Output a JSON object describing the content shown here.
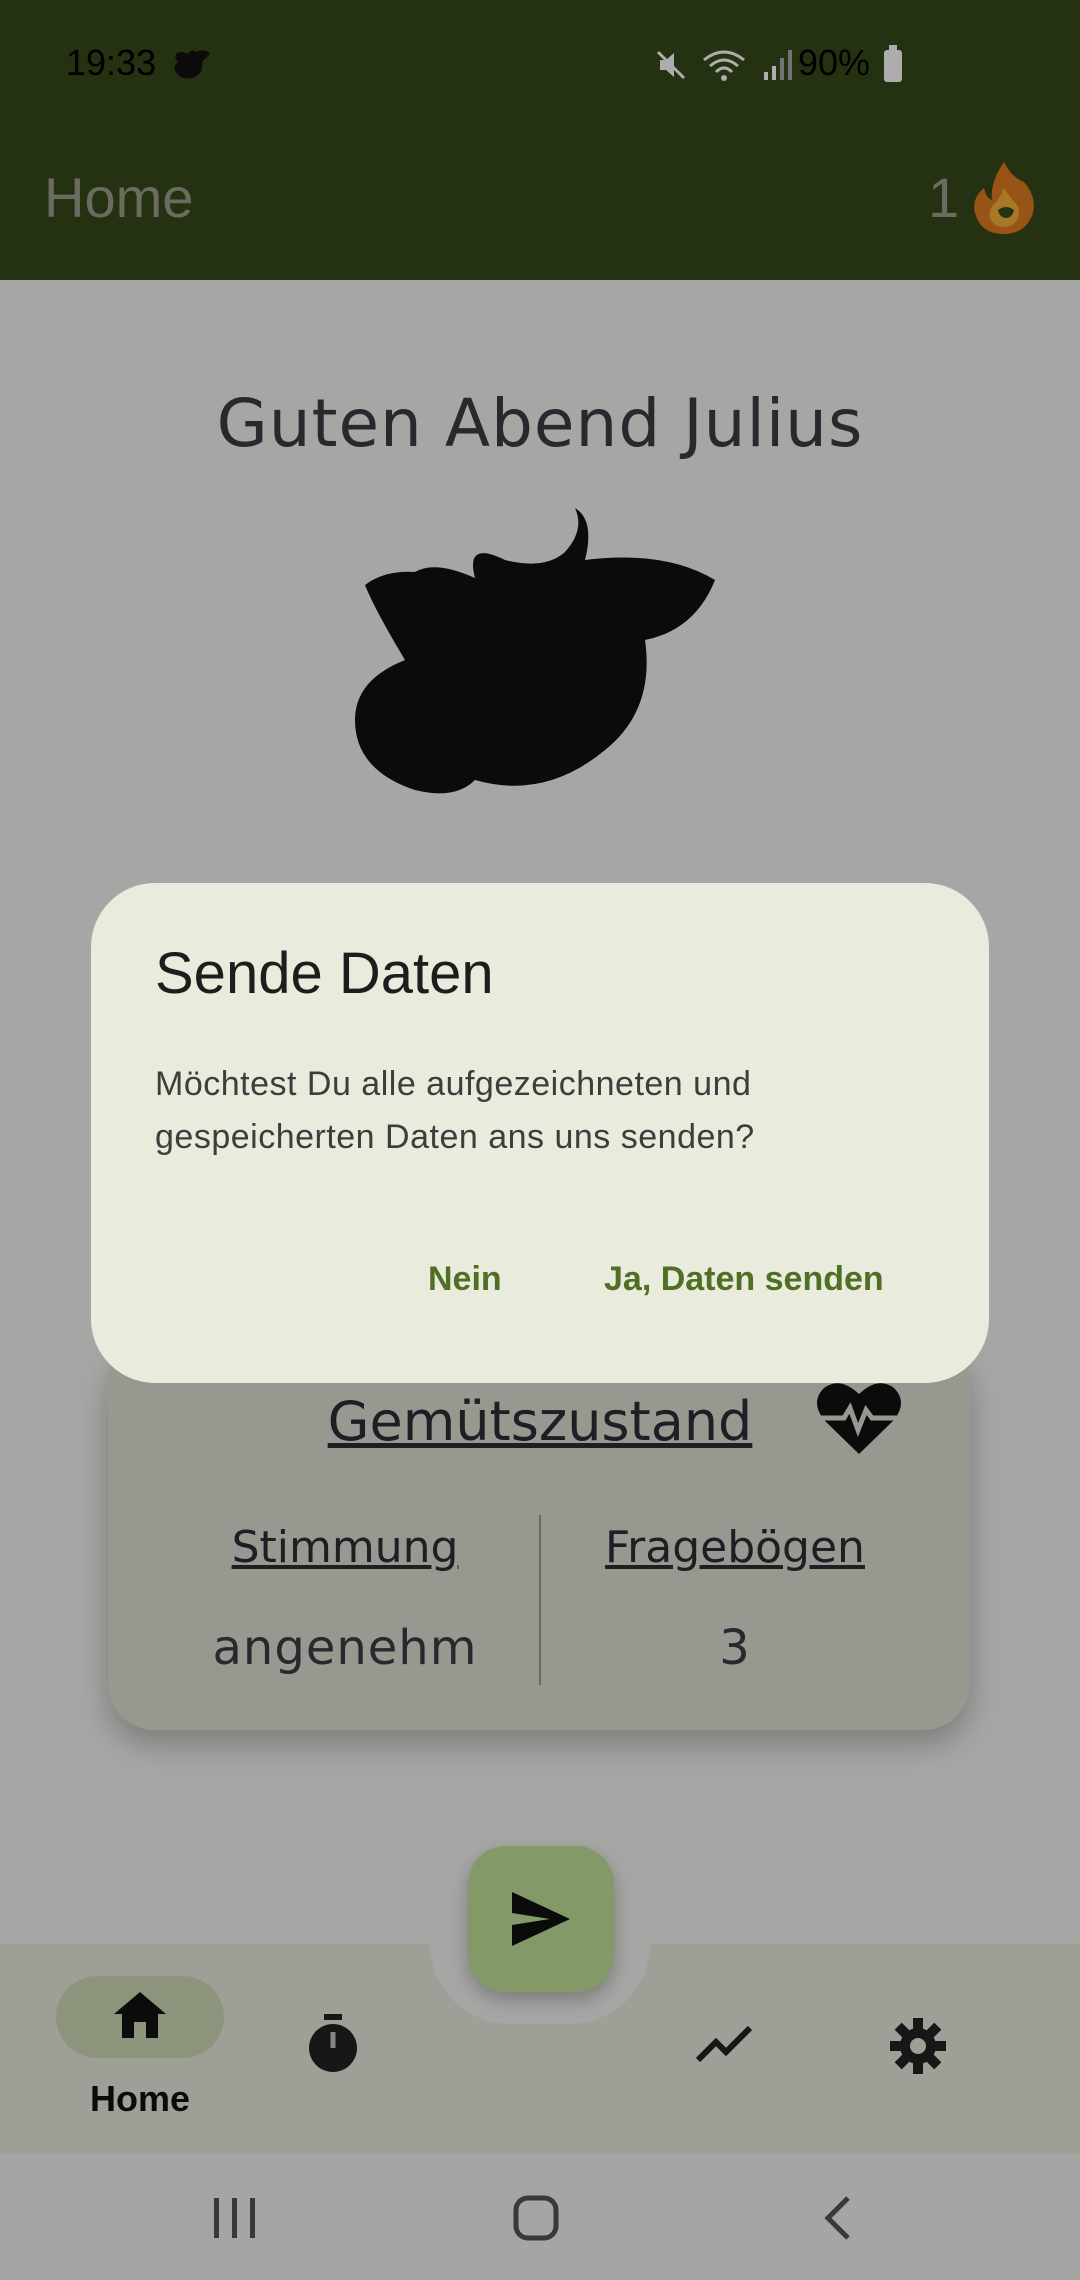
{
  "status_bar": {
    "time": "19:33",
    "battery": "90%"
  },
  "app_bar": {
    "title": "Home",
    "streak_count": "1"
  },
  "home": {
    "greeting": "Guten Abend Julius"
  },
  "mood_card": {
    "title": "Gemütszustand",
    "columns": [
      {
        "title": "Stimmung",
        "value": "angenehm"
      },
      {
        "title": "Fragebögen",
        "value": "3"
      }
    ]
  },
  "bottom_nav": {
    "items": [
      {
        "label": "Home",
        "icon": "home-icon",
        "selected": true
      },
      {
        "label": "",
        "icon": "timer-icon",
        "selected": false
      },
      {
        "label": "",
        "icon": "trending-icon",
        "selected": false
      },
      {
        "label": "",
        "icon": "gear-icon",
        "selected": false
      }
    ]
  },
  "dialog": {
    "title": "Sende Daten",
    "body": "Möchtest Du alle aufgezeichneten und gespeicherten Daten ans uns senden?",
    "cancel_label": "Nein",
    "confirm_label": "Ja, Daten senden"
  },
  "colors": {
    "app_bar": "#374a1a",
    "accent": "#4f6f25",
    "fab": "#c2e39a",
    "dialog_bg": "#e9ebdd"
  }
}
